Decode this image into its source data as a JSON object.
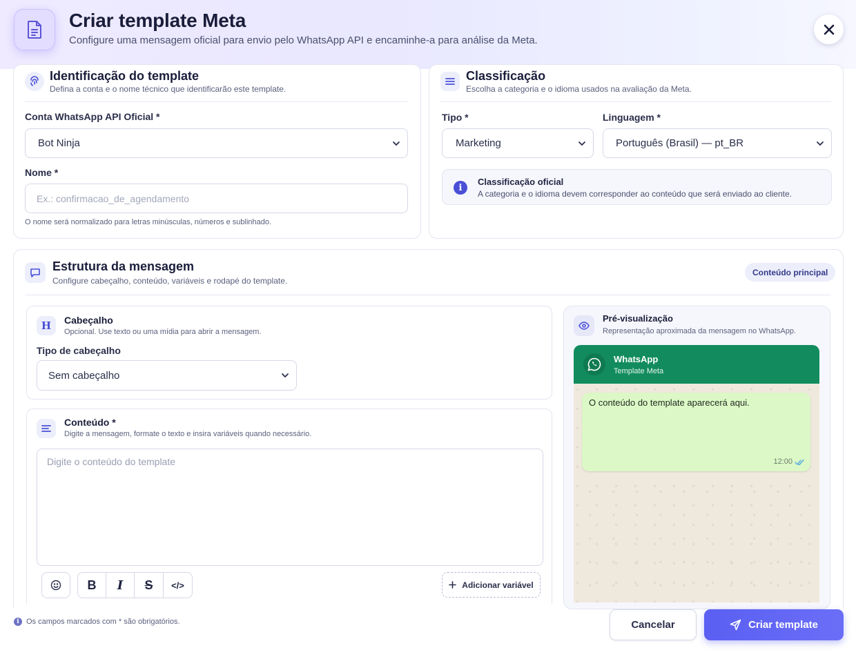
{
  "header": {
    "title": "Criar template Meta",
    "subtitle": "Configure uma mensagem oficial para envio pelo WhatsApp API e encaminhe-a para análise da Meta."
  },
  "identification": {
    "title": "Identificação do template",
    "subtitle": "Defina a conta e o nome técnico que identificarão este template.",
    "account_label": "Conta WhatsApp API Oficial *",
    "account_value": "Bot Ninja",
    "name_label": "Nome *",
    "name_placeholder": "Ex.: confirmacao_de_agendamento",
    "name_value": "",
    "name_hint": "O nome será normalizado para letras minúsculas, números e sublinhado."
  },
  "classification": {
    "title": "Classificação",
    "subtitle": "Escolha a categoria e o idioma usados na avaliação da Meta.",
    "type_label": "Tipo *",
    "type_value": "Marketing",
    "language_label": "Linguagem *",
    "language_value": "Português (Brasil) — pt_BR",
    "info_title": "Classificação oficial",
    "info_text": "A categoria e o idioma devem corresponder ao conteúdo que será enviado ao cliente."
  },
  "structure": {
    "title": "Estrutura da mensagem",
    "subtitle": "Configure cabeçalho, conteúdo, variáveis e rodapé do template.",
    "badge": "Conteúdo principal"
  },
  "header_section": {
    "title": "Cabeçalho",
    "subtitle": "Opcional. Use texto ou uma mídia para abrir a mensagem.",
    "type_label": "Tipo de cabeçalho",
    "type_value": "Sem cabeçalho"
  },
  "content_section": {
    "title": "Conteúdo *",
    "subtitle": "Digite a mensagem, formate o texto e insira variáveis quando necessário.",
    "placeholder": "Digite o conteúdo do template",
    "value": "",
    "toolbar": {
      "bold": "B",
      "italic": "I",
      "strike": "S",
      "code": "</>",
      "add_variable": "Adicionar variável"
    }
  },
  "preview": {
    "title": "Pré-visualização",
    "subtitle": "Representação aproximada da mensagem no WhatsApp.",
    "chat_name": "WhatsApp",
    "chat_sub": "Template Meta",
    "message": "O conteúdo do template aparecerá aqui.",
    "time": "12:00"
  },
  "footer": {
    "note": "Os campos marcados com * são obrigatórios.",
    "cancel": "Cancelar",
    "create": "Criar template"
  },
  "colors": {
    "accent": "#5b5ff2",
    "whatsapp_green": "#128c5e",
    "bubble": "#dcf8c6"
  },
  "icons": {
    "header": "document-icon",
    "close": "close-icon",
    "identification": "fingerprint-icon",
    "classification": "sliders-icon",
    "structure": "message-square-icon",
    "header_section": "heading-h-icon",
    "content_section": "align-left-icon",
    "preview": "eye-icon",
    "emoji": "smiley-icon",
    "add_variable": "plus-icon",
    "create": "send-icon",
    "info": "info-icon"
  }
}
